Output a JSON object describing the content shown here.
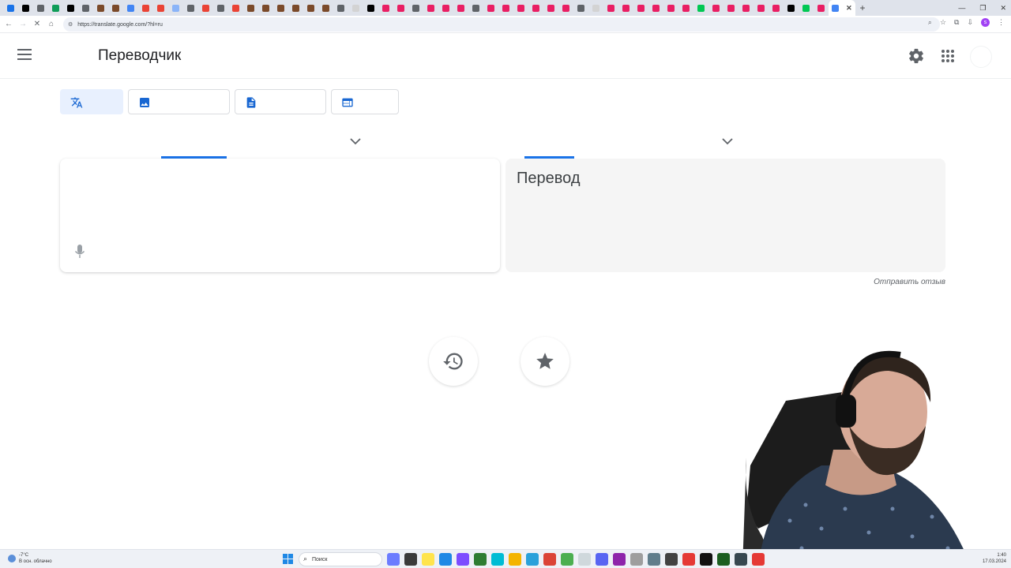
{
  "browser": {
    "url": "https://translate.google.com/?hl=ru",
    "tab_close_glyph": "✕",
    "new_tab_glyph": "+",
    "tab_favicon_colors": [
      "#1a73e8",
      "#000000",
      "#5f6368",
      "#0f9d58",
      "#000000",
      "#5f6368",
      "#7b4a2a",
      "#7b4a2a",
      "#4285f4",
      "#ea4335",
      "#ea4335",
      "#8ab4f8",
      "#5f6368",
      "#ea4335",
      "#5f6368",
      "#ea4335",
      "#7b4a2a",
      "#7b4a2a",
      "#7b4a2a",
      "#7b4a2a",
      "#7b4a2a",
      "#7b4a2a",
      "#5f6368",
      "#d3d3d3",
      "#000000",
      "#e91e63",
      "#e91e63",
      "#5f6368",
      "#e91e63",
      "#e91e63",
      "#e91e63",
      "#5f6368",
      "#e91e63",
      "#e91e63",
      "#e91e63",
      "#e91e63",
      "#e91e63",
      "#e91e63",
      "#5f6368",
      "#d3d3d3",
      "#e91e63",
      "#e91e63",
      "#e91e63",
      "#e91e63",
      "#e91e63",
      "#e91e63",
      "#00c853",
      "#e91e63",
      "#e91e63",
      "#e91e63",
      "#e91e63",
      "#e91e63",
      "#000000",
      "#00c853",
      "#e91e63"
    ]
  },
  "header": {
    "title": "Переводчик"
  },
  "modes": [
    {
      "name": "text",
      "icon": "translate-icon"
    },
    {
      "name": "images",
      "icon": "image-icon"
    },
    {
      "name": "documents",
      "icon": "document-icon"
    },
    {
      "name": "websites",
      "icon": "website-icon"
    }
  ],
  "target": {
    "placeholder": "Перевод"
  },
  "feedback_label": "Отправить отзыв",
  "taskbar": {
    "weather_temp": "-7°C",
    "weather_text": "В осн. облачно",
    "search_label": "Поиск",
    "time": "1:40",
    "date": "17.03.2024"
  },
  "colors": {
    "accent": "#1a73e8",
    "target_bg": "#f5f5f5"
  }
}
